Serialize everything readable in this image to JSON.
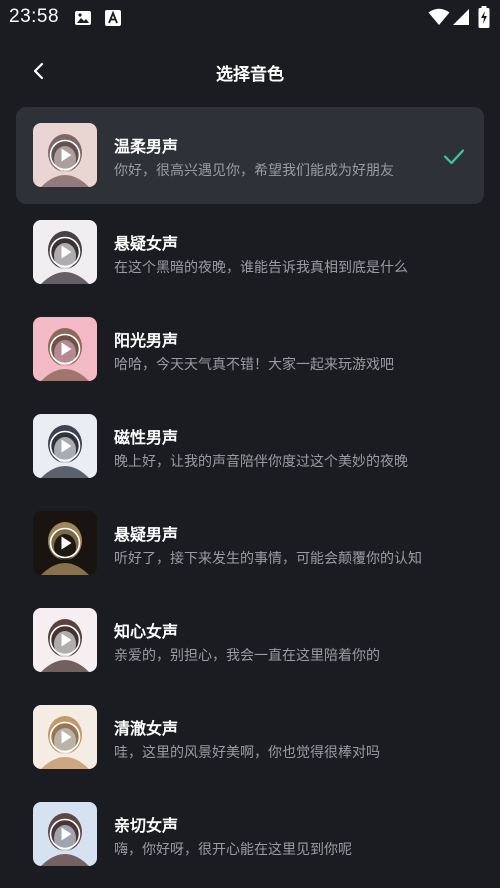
{
  "status_bar": {
    "time": "23:58",
    "left_icons": [
      "image-icon",
      "text-a-icon"
    ],
    "right_icons": [
      "wifi-icon",
      "signal-icon",
      "battery-charging-icon"
    ]
  },
  "header": {
    "title": "选择音色",
    "back_icon": "chevron-left-icon"
  },
  "accent_color": "#3ec6a0",
  "voices": [
    {
      "name": "温柔男声",
      "desc": "你好，很高兴遇见你，希望我们能成为好朋友",
      "selected": true,
      "avatar_colors": [
        "#e9d6d2",
        "#6b5555"
      ]
    },
    {
      "name": "悬疑女声",
      "desc": "在这个黑暗的夜晚，谁能告诉我真相到底是什么",
      "selected": false,
      "avatar_colors": [
        "#f1eef2",
        "#2a2226"
      ]
    },
    {
      "name": "阳光男声",
      "desc": "哈哈，今天天气真不错！大家一起来玩游戏吧",
      "selected": false,
      "avatar_colors": [
        "#f3b9c4",
        "#7a5a48"
      ]
    },
    {
      "name": "磁性男声",
      "desc": "晚上好，让我的声音陪伴你度过这个美妙的夜晚",
      "selected": false,
      "avatar_colors": [
        "#e9eef4",
        "#1e2433"
      ]
    },
    {
      "name": "悬疑男声",
      "desc": "听好了，接下来发生的事情，可能会颠覆你的认知",
      "selected": false,
      "avatar_colors": [
        "#1a1410",
        "#b89a6a"
      ]
    },
    {
      "name": "知心女声",
      "desc": "亲爱的，别担心，我会一直在这里陪着你的",
      "selected": false,
      "avatar_colors": [
        "#f6eef0",
        "#3a2420"
      ]
    },
    {
      "name": "清澈女声",
      "desc": "哇，这里的风景好美啊，你也觉得很棒对吗",
      "selected": false,
      "avatar_colors": [
        "#f5ece3",
        "#b98a58"
      ]
    },
    {
      "name": "亲切女声",
      "desc": "嗨，你好呀，很开心能在这里见到你呢",
      "selected": false,
      "avatar_colors": [
        "#d6e2f2",
        "#4a2c26"
      ]
    }
  ]
}
